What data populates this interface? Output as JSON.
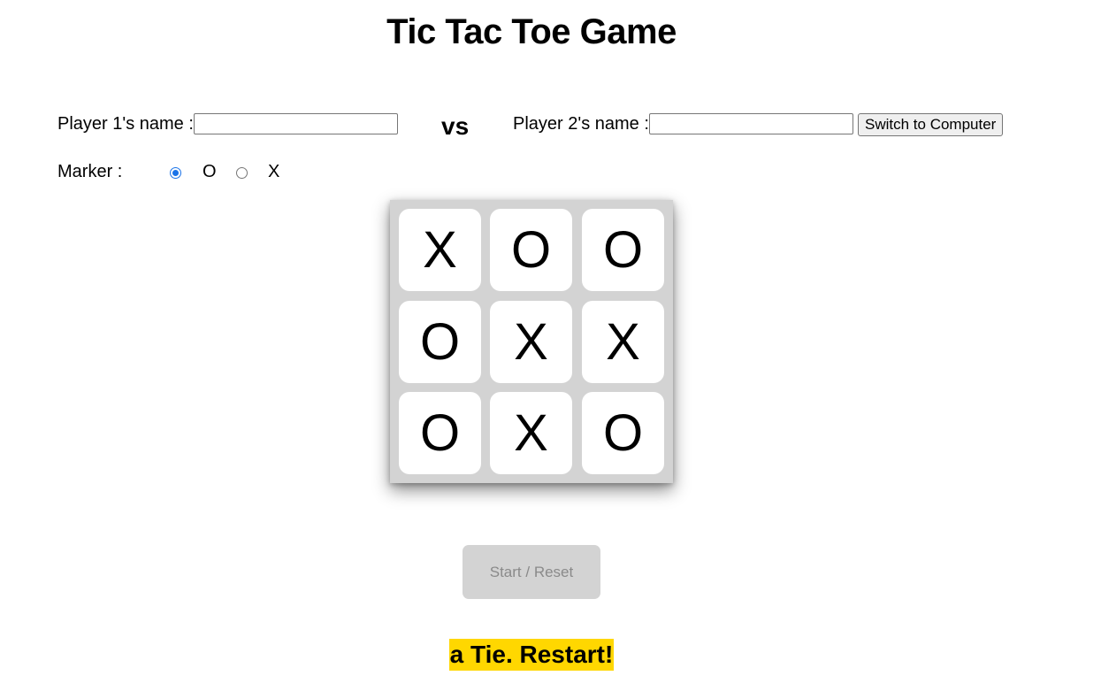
{
  "title": "Tic Tac Toe Game",
  "player1": {
    "label": "Player 1's name :",
    "value": ""
  },
  "vs_label": "vs",
  "player2": {
    "label": "Player 2's name :",
    "value": "",
    "switch_label": "Switch to Computer"
  },
  "marker": {
    "label": "Marker :",
    "options": [
      {
        "label": "O",
        "checked": true
      },
      {
        "label": "X",
        "checked": false
      }
    ],
    "accent_color": "#1a73e8"
  },
  "board": {
    "cells": [
      "X",
      "O",
      "O",
      "O",
      "X",
      "X",
      "O",
      "X",
      "O"
    ],
    "background_color": "#d3d3d3"
  },
  "start_reset_label": "Start / Reset",
  "result_message": "a Tie. Restart!",
  "result_highlight_color": "#ffd700"
}
